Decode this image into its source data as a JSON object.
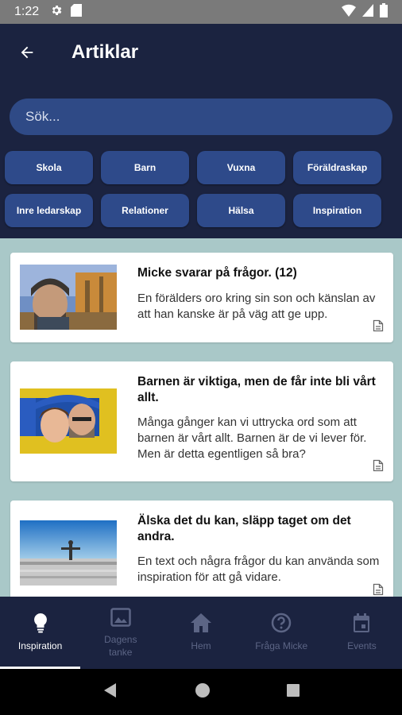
{
  "status": {
    "time": "1:22"
  },
  "header": {
    "title": "Artiklar"
  },
  "search": {
    "placeholder": "Sök..."
  },
  "categories": [
    "Skola",
    "Barn",
    "Vuxna",
    "Föräldraskap",
    "Inre ledarskap",
    "Relationer",
    "Hälsa",
    "Inspiration"
  ],
  "articles": [
    {
      "title": "Micke svarar på frågor. (12)",
      "description": "En förälders oro kring sin son och känslan av att han kanske är på väg att ge upp."
    },
    {
      "title": "Barnen är viktiga, men de får inte bli vårt allt.",
      "description": "Många gånger kan vi uttrycka ord som att barnen är vårt allt. Barnen är de vi lever för. Men är detta egentligen så bra?"
    },
    {
      "title": "Älska det du kan, släpp taget om det andra.",
      "description": "En text och några frågor du kan använda som inspiration för att gå vidare."
    }
  ],
  "nav": [
    {
      "label": "Inspiration",
      "icon": "lightbulb-icon",
      "active": true
    },
    {
      "label": "Dagens tanke",
      "icon": "image-icon",
      "active": false
    },
    {
      "label": "Hem",
      "icon": "home-icon",
      "active": false
    },
    {
      "label": "Fråga Micke",
      "icon": "help-circle-icon",
      "active": false
    },
    {
      "label": "Events",
      "icon": "calendar-icon",
      "active": false
    }
  ],
  "colors": {
    "header_bg": "#1b2340",
    "chip_bg": "#2e4a8a",
    "search_bg": "#2f4a86",
    "content_bg": "#a9c8c8",
    "nav_inactive": "#5c6585"
  }
}
